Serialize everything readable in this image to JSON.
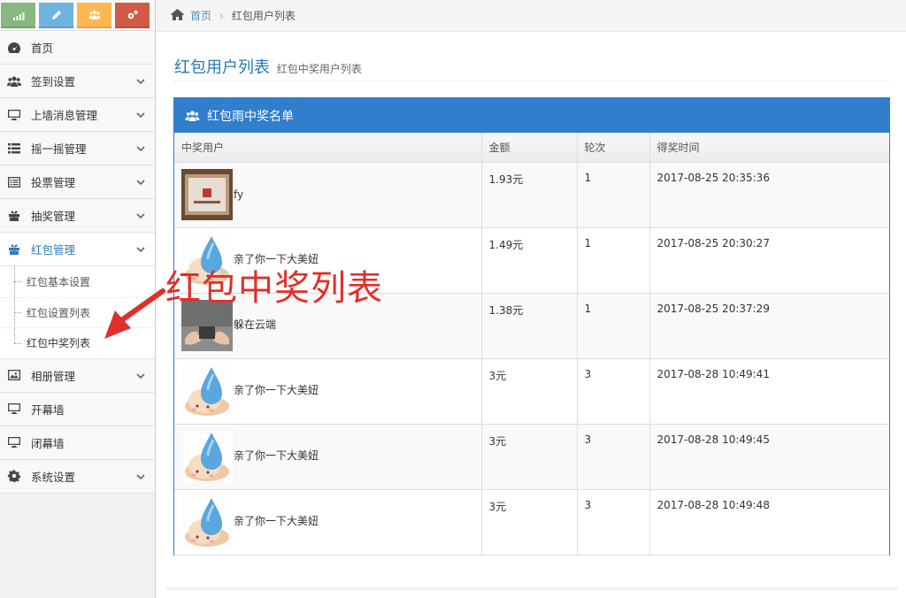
{
  "shortcuts": [
    {
      "icon": "signal-icon",
      "color": "#87b87f"
    },
    {
      "icon": "pencil-icon",
      "color": "#6fb3e0"
    },
    {
      "icon": "users-icon",
      "color": "#ffb752"
    },
    {
      "icon": "cogs-icon",
      "color": "#d15b47"
    }
  ],
  "sidebar": {
    "items": [
      {
        "label": "首页",
        "icon": "dashboard-icon"
      },
      {
        "label": "签到设置",
        "icon": "users-icon"
      },
      {
        "label": "上墙消息管理",
        "icon": "desktop-icon"
      },
      {
        "label": "摇一摇管理",
        "icon": "list-icon"
      },
      {
        "label": "投票管理",
        "icon": "list-alt-icon"
      },
      {
        "label": "抽奖管理",
        "icon": "gift-icon"
      },
      {
        "label": "红包管理",
        "icon": "gift-icon"
      },
      {
        "label": "相册管理",
        "icon": "picture-icon"
      },
      {
        "label": "开幕墙",
        "icon": "desktop-icon"
      },
      {
        "label": "闭幕墙",
        "icon": "desktop-icon"
      },
      {
        "label": "系统设置",
        "icon": "cog-icon"
      }
    ],
    "submenu": [
      {
        "label": "红包基本设置"
      },
      {
        "label": "红包设置列表"
      },
      {
        "label": "红包中奖列表"
      }
    ]
  },
  "breadcrumb": {
    "home": "首页",
    "current": "红包用户列表"
  },
  "page": {
    "title": "红包用户列表",
    "subtitle": "红包中奖用户列表"
  },
  "widget": {
    "title": "红包雨中奖名单"
  },
  "table": {
    "headers": [
      "中奖用户",
      "金额",
      "轮次",
      "得奖时间"
    ],
    "rows": [
      {
        "user": "fy",
        "amount": "1.93元",
        "round": "1",
        "time": "2017-08-25 20:35:36",
        "avatar": "photo"
      },
      {
        "user": "亲了你一下大美妞",
        "amount": "1.49元",
        "round": "1",
        "time": "2017-08-25 20:30:27",
        "avatar": "cartoon"
      },
      {
        "user": "躲在云端",
        "amount": "1.38元",
        "round": "1",
        "time": "2017-08-25 20:37:29",
        "avatar": "hands"
      },
      {
        "user": "亲了你一下大美妞",
        "amount": "3元",
        "round": "3",
        "time": "2017-08-28 10:49:41",
        "avatar": "cartoon"
      },
      {
        "user": "亲了你一下大美妞",
        "amount": "3元",
        "round": "3",
        "time": "2017-08-28 10:49:45",
        "avatar": "cartoon"
      },
      {
        "user": "亲了你一下大美妞",
        "amount": "3元",
        "round": "3",
        "time": "2017-08-28 10:49:48",
        "avatar": "cartoon"
      }
    ]
  },
  "annotation": {
    "text": "红包中奖列表",
    "color": "#e0302a"
  },
  "colors": {
    "accent": "#307ecc",
    "link": "#4c8fbd",
    "title": "#2679b5"
  }
}
